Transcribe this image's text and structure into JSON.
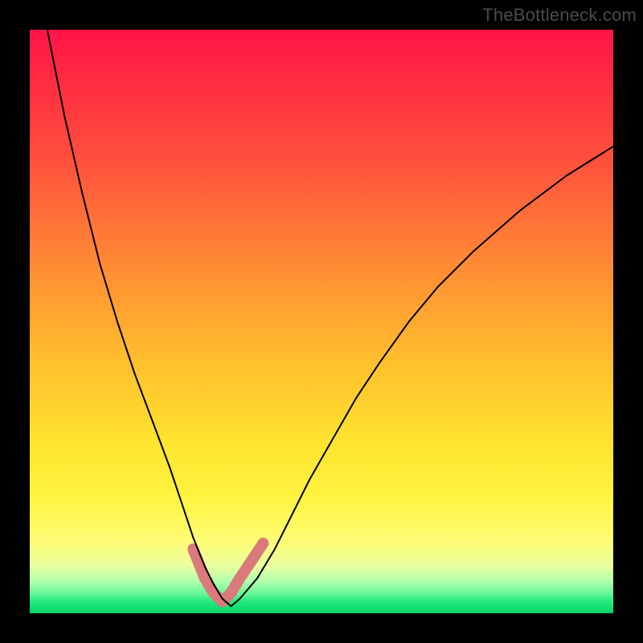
{
  "watermark": "TheBottleneck.com",
  "chart_data": {
    "type": "line",
    "title": "",
    "xlabel": "",
    "ylabel": "",
    "xlim": [
      0,
      100
    ],
    "ylim": [
      0,
      100
    ],
    "grid": false,
    "legend": false,
    "series": [
      {
        "name": "thin-curve",
        "stroke": "#000000",
        "stroke_width": 2,
        "x": [
          3,
          6,
          9,
          12,
          15,
          18,
          21,
          24,
          26,
          28,
          30,
          31.5,
          33,
          34.5,
          36,
          39,
          42,
          45,
          48,
          52,
          56,
          60,
          65,
          70,
          76,
          84,
          92,
          100
        ],
        "y": [
          100,
          85,
          72,
          60,
          50,
          41,
          33,
          25,
          19,
          13,
          8,
          5,
          2.5,
          1.2,
          2.5,
          6,
          11,
          17,
          23,
          30,
          37,
          43,
          50,
          56,
          62,
          69,
          75,
          80
        ]
      },
      {
        "name": "thick-pink-segment",
        "stroke": "#d97b7b",
        "stroke_width": 14,
        "x": [
          28,
          30,
          31.5,
          33,
          34.5,
          36,
          38,
          40
        ],
        "y": [
          11,
          6,
          3.5,
          2,
          3.5,
          6,
          9,
          12
        ]
      }
    ],
    "gradient_bands": [
      {
        "position": 0.0,
        "color": "#ff1448"
      },
      {
        "position": 0.4,
        "color": "#ff8a34"
      },
      {
        "position": 0.7,
        "color": "#ffe22e"
      },
      {
        "position": 0.92,
        "color": "#e8ffa0"
      },
      {
        "position": 1.0,
        "color": "#00d46c"
      }
    ]
  }
}
